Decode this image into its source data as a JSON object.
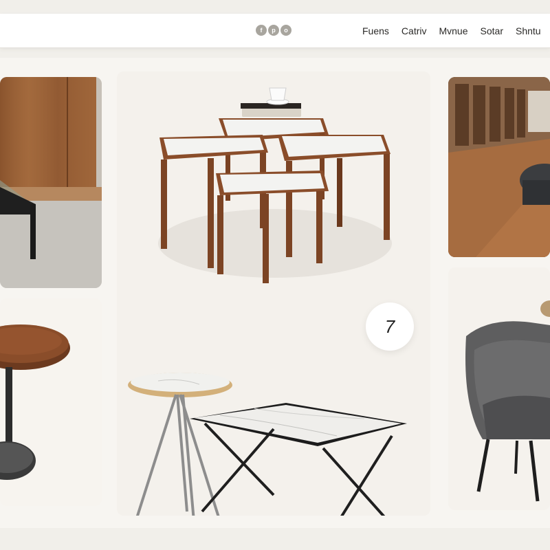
{
  "nav": {
    "social_icons": [
      {
        "name": "facebook-icon",
        "glyph": "f"
      },
      {
        "name": "pinterest-icon",
        "glyph": "p"
      },
      {
        "name": "instagram-icon",
        "glyph": "o"
      }
    ],
    "links": [
      {
        "name": "nav-link-fuens",
        "label": "Fuens"
      },
      {
        "name": "nav-link-catriv",
        "label": "Catriv"
      },
      {
        "name": "nav-link-mvnue",
        "label": "Mvnue"
      },
      {
        "name": "nav-link-sotar",
        "label": "Sotar"
      },
      {
        "name": "nav-link-shntu",
        "label": "Shntu"
      }
    ]
  },
  "gallery": {
    "count_badge": "7"
  },
  "colors": {
    "background": "#f1efea",
    "card": "#f5f2ed",
    "walnut": "#8a4f2c",
    "marble": "#f3f3f1",
    "steel": "#2a2a2a"
  }
}
